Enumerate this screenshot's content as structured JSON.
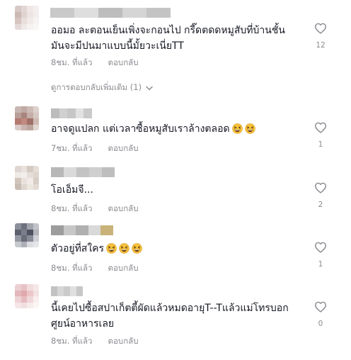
{
  "comments": [
    {
      "text_lines": [
        "ออมอ ละตอนเย็นเพิ่งจะกอนไป กรี๊ดตดดหมูสับที่บ้านชั้น",
        "มันจะมีปนมาแบบนี้มั้ยวะเนี่ยTT"
      ],
      "time": "8ชม. ที่แล้ว",
      "reply": "ตอบกลับ",
      "likes": "12",
      "avatar_colors": [
        "#d8c9c6",
        "#e2d7d5",
        "#efe8e6",
        "#f4efee",
        "#cdb9b4",
        "#e0d2cf",
        "#ece5e3",
        "#f2eeed",
        "#d6c5c1",
        "#e8dedb",
        "#f0eae8",
        "#f6f3f2",
        "#e3d9d6",
        "#efe9e7",
        "#f5f2f1",
        "#f9f7f6"
      ],
      "username_colors": [
        "#c9c9c9",
        "#dedede",
        "#bdbdbd",
        "#d5d5d5",
        "#c4c4c4"
      ]
    },
    {
      "text_lines": [
        "อาจดูแปลก แต่เวลาซื้อหมูสับเราล้างตลอด"
      ],
      "emoji_count": 2,
      "time": "7ชม. ที่แล้ว",
      "reply": "ตอบกลับ",
      "likes": "1",
      "avatar_colors": [
        "#c7b7b2",
        "#bfa9a3",
        "#cdbcb6",
        "#ddd1cc",
        "#b99f98",
        "#a8857c",
        "#c4aea7",
        "#d6c8c3",
        "#b47a70",
        "#c08a80",
        "#a07168",
        "#cfbbb4",
        "#d9ccc7",
        "#c9b3ad",
        "#bda59e",
        "#e2d8d4"
      ],
      "username_colors": [
        "#bcbcbc",
        "#d0d0d0",
        "#c6c6c6",
        "#e2e2e2",
        "#cacaca"
      ]
    },
    {
      "text_lines": [
        "โอเอ็มจี..."
      ],
      "time": "8ชม. ที่แล้ว",
      "reply": "ตอบกลับ",
      "likes": "2",
      "avatar_colors": [
        "#ded6d0",
        "#e8e1dc",
        "#d4cac3",
        "#e5ddd7",
        "#efe9e4",
        "#f3eeeb",
        "#e6dfd9",
        "#ddd4cd",
        "#d1c5bc",
        "#e9e2dc",
        "#f0ebe7",
        "#d8cec6",
        "#c9bcb2",
        "#dfd6cf",
        "#ece6e1",
        "#e3dbd4"
      ],
      "username_colors": [
        "#b7b7b7",
        "#dadada",
        "#c3c3c3",
        "#cfcfcf",
        "#bebebe"
      ]
    },
    {
      "text_lines": [
        "ตัวอยู่ที่สใคร"
      ],
      "emoji_count": 3,
      "time": "8ชม. ที่แล้ว",
      "reply": "ตอบกลับ",
      "likes": "1",
      "avatar_colors": [
        "#8d8f9b",
        "#6f7180",
        "#a2a4ad",
        "#c2c3c9",
        "#5d606e",
        "#7b7d8b",
        "#4e5160",
        "#b3b4bb",
        "#9698a3",
        "#6a6c79",
        "#888a96",
        "#cfd0d5",
        "#c8c9ce",
        "#aeb0b8",
        "#dcdde0",
        "#e5e6e8"
      ],
      "username_colors": [
        "#9c9c9c",
        "#c7c7c7",
        "#b0b0b0",
        "#d9d9d9",
        "#c9b27a"
      ]
    },
    {
      "text_lines": [
        "นี้เคยไปซื้อสปาเก็ตตี้ผัดแล้วหมดอายุT--Tแล้วแม่โทรบอก",
        "ศูยน์อาหารเลย"
      ],
      "time": "8ชม. ที่แล้ว",
      "reply": "ตอบกลับ",
      "likes": "0",
      "avatar_colors": [
        "#eccfd1",
        "#e7c2c5",
        "#f2dcdd",
        "#f6e8e9",
        "#e3b7bb",
        "#dfa9ae",
        "#ecc7ca",
        "#f4e2e3",
        "#eed3d5",
        "#e6bcc0",
        "#f0d7d9",
        "#f8eeef",
        "#f5e6e7",
        "#f1dfe0",
        "#f7ecec",
        "#fbf5f5"
      ],
      "username_colors": [
        "#c2c2c2",
        "#d6d6d6",
        "#cbcbcb",
        "#e0e0e0",
        "#c8c8c8"
      ]
    }
  ],
  "view_more_replies": "ดูการตอบกลับเพิ่มเติม (1)",
  "icons": {
    "like": "heart-outline-icon",
    "expand": "chevron-down-icon",
    "emoji": "grinning-squinting-face-emoji"
  },
  "colors": {
    "text": "#161823",
    "meta": "#8a8b91",
    "emoji_face": "#f7c23b"
  }
}
